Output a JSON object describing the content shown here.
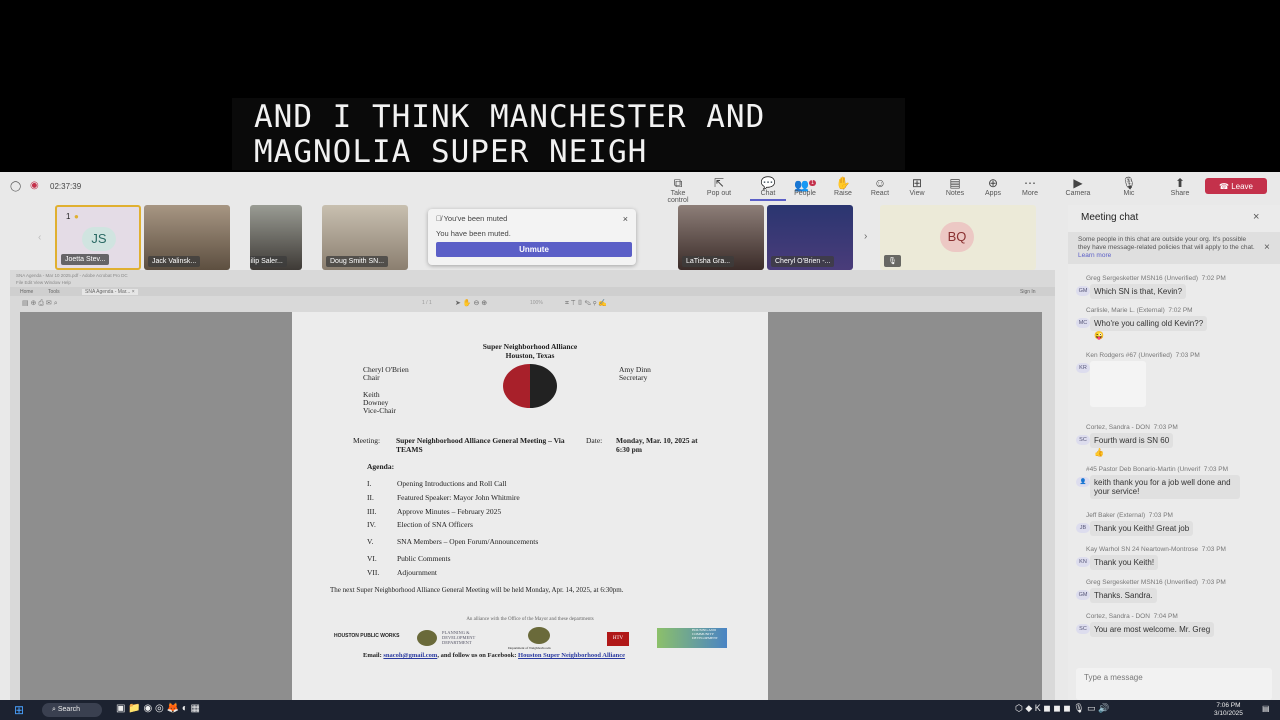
{
  "caption": {
    "line1": "AND I THINK MANCHESTER AND",
    "line2": "MAGNOLIA SUPER NEIGH"
  },
  "meeting": {
    "timer": "02:37:39"
  },
  "toolbar": [
    {
      "label": "Take control",
      "icon": "⧉"
    },
    {
      "label": "Pop out",
      "icon": "⇱"
    },
    {
      "label": "Chat",
      "icon": "💬"
    },
    {
      "label": "People",
      "icon": "👥",
      "badge": "1"
    },
    {
      "label": "Raise",
      "icon": "✋"
    },
    {
      "label": "React",
      "icon": "☺"
    },
    {
      "label": "View",
      "icon": "⊞"
    },
    {
      "label": "Notes",
      "icon": "▤"
    },
    {
      "label": "Apps",
      "icon": "⊕"
    },
    {
      "label": "More",
      "icon": "⋯"
    },
    {
      "label": "Camera",
      "icon": "▶"
    },
    {
      "label": "Mic",
      "icon": "🎙"
    },
    {
      "label": "Share",
      "icon": "⬆"
    }
  ],
  "leave_label": "Leave",
  "participants": [
    {
      "name": "Joetta Stev...",
      "initials": "JS",
      "hand": "1"
    },
    {
      "name": "Jack Valinsk..."
    },
    {
      "name": "Philip Saler..."
    },
    {
      "name": "Doug Smith SN..."
    },
    {
      "name": "LaTisha Gra..."
    },
    {
      "name": "Cheryl O'Brien -..."
    },
    {
      "name": "",
      "initials": "BQ"
    }
  ],
  "toast": {
    "title": "You've been muted",
    "body": "You have been muted.",
    "button": "Unmute"
  },
  "acrobat": {
    "title": "SNA Agenda - Mar 10 2025.pdf - Adobe Acrobat Pro DC",
    "menu": "File  Edit  View  Window  Help",
    "tabs": [
      "Home",
      "Tools",
      "SNA Agenda - Mar... ×"
    ],
    "sign_in": "Sign In",
    "zoom": "100%",
    "page": "1 / 1"
  },
  "document": {
    "title1": "Super Neighborhood Alliance",
    "title2": "Houston, Texas",
    "chair_name": "Cheryl O'Brien",
    "chair_role": "Chair",
    "vice_name": "Keith Downey",
    "vice_role": "Vice-Chair",
    "sec_name": "Amy Dinn",
    "sec_role": "Secretary",
    "meeting_label": "Meeting:",
    "meeting_value": "Super Neighborhood Alliance General Meeting – Via TEAMS",
    "date_label": "Date:",
    "date_value": "Monday, Mar. 10, 2025 at 6:30 pm",
    "agenda_label": "Agenda:",
    "agenda": [
      {
        "n": "I.",
        "t": "Opening Introductions and Roll Call"
      },
      {
        "n": "II.",
        "t": "Featured Speaker: Mayor John Whitmire"
      },
      {
        "n": "III.",
        "t": "Approve Minutes – February 2025"
      },
      {
        "n": "IV.",
        "t": "Election of SNA Officers"
      },
      {
        "n": "V.",
        "t": "SNA Members – Open Forum/Announcements"
      },
      {
        "n": "VI.",
        "t": "Public Comments"
      },
      {
        "n": "VII.",
        "t": "Adjournment"
      }
    ],
    "next_meeting": "The next Super Neighborhood Alliance General Meeting will be held Monday, Apr. 14, 2025, at 6:30pm.",
    "alliance": "An alliance with the Office of the Mayor and these departments",
    "logos": [
      "HOUSTON PUBLIC WORKS",
      "PLANNING & DEVELOPMENT DEPARTMENT",
      "Department of Neighborhoods",
      "HTV",
      "HOUSING AND COMMUNITY DEVELOPMENT"
    ],
    "email_label": "Email:",
    "email": "snacoh@gmail.com",
    "follow": ", and follow us on Facebook:",
    "facebook": "Houston Super Neighborhood Alliance"
  },
  "chat": {
    "title": "Meeting chat",
    "notice": "Some people in this chat are outside your org. It's possible they have message-related policies that will apply to the chat.",
    "learn_more": "Learn more",
    "placeholder": "Type a message",
    "messages": [
      {
        "sender": "Greg Sergesketter MSN16 (Unverified)",
        "time": "7:02 PM",
        "initials": "GM",
        "text": "Which SN is that, Kevin?"
      },
      {
        "sender": "Carlisle, Marie L. (External)",
        "time": "7:02 PM",
        "initials": "MC",
        "text": "Who're you calling old Kevin??",
        "emoji": "😜"
      },
      {
        "sender": "Ken Rodgers #67 (Unverified)",
        "time": "7:03 PM",
        "initials": "KR",
        "text": ""
      },
      {
        "sender": "Cortez, Sandra - DON",
        "time": "7:03 PM",
        "initials": "SC",
        "text": "Fourth ward is SN 60",
        "emoji": "👍"
      },
      {
        "sender": "#45 Pastor Deb Bonario-Martin (Unverif",
        "time": "7:03 PM",
        "initials": "",
        "text": "keith thank you for a job well done and your service!"
      },
      {
        "sender": "Jeff Baker (External)",
        "time": "7:03 PM",
        "initials": "JB",
        "text": "Thank you Keith!  Great job"
      },
      {
        "sender": "Kay Warhol SN 24 Neartown-Montrose",
        "time": "7:03 PM",
        "initials": "KN",
        "text": "Thank you Keith!"
      },
      {
        "sender": "Greg Sergesketter MSN16 (Unverified)",
        "time": "7:03 PM",
        "initials": "GM",
        "text": "Thanks. Sandra."
      },
      {
        "sender": "Cortez, Sandra - DON",
        "time": "7:04 PM",
        "initials": "SC",
        "text": "You are most welcome. Mr. Greg"
      }
    ]
  },
  "taskbar": {
    "search": "Search",
    "time": "7:06 PM",
    "date": "3/10/2025"
  },
  "colors": {
    "leave": "#c4314b",
    "unmute": "#5b5fc7",
    "caption_bg": "#0a0a0a"
  }
}
